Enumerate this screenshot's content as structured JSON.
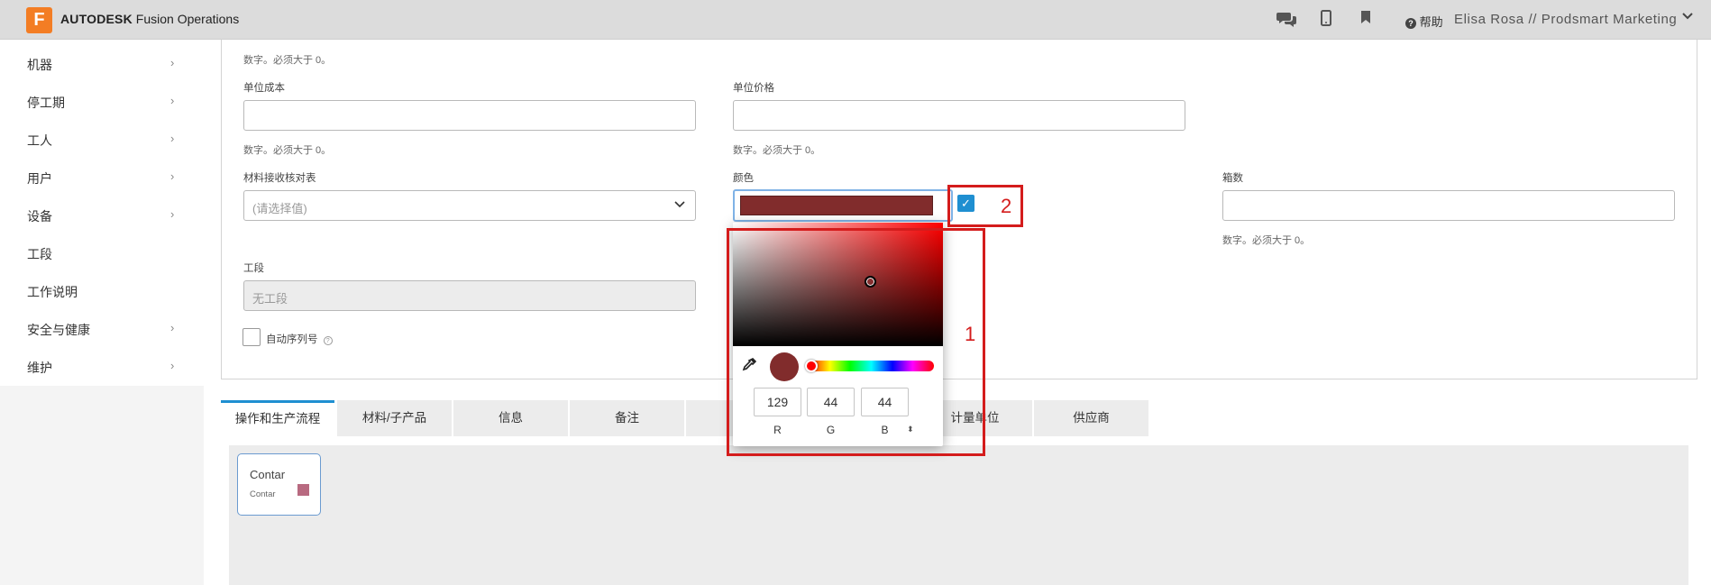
{
  "app": {
    "logo_letter": "F",
    "brand_bold": "AUTODESK",
    "brand_rest": " Fusion Operations"
  },
  "header": {
    "help_label": "帮助",
    "user_label": "Elisa Rosa // Prodsmart Marketing"
  },
  "sidebar": {
    "items": [
      {
        "label": "机器",
        "has_chevron": true
      },
      {
        "label": "停工期",
        "has_chevron": true
      },
      {
        "label": "工人",
        "has_chevron": true
      },
      {
        "label": "用户",
        "has_chevron": true
      },
      {
        "label": "设备",
        "has_chevron": true
      },
      {
        "label": "工段",
        "has_chevron": false
      },
      {
        "label": "工作说明",
        "has_chevron": false
      },
      {
        "label": "安全与健康",
        "has_chevron": true
      },
      {
        "label": "维护",
        "has_chevron": true
      }
    ],
    "chevron": "›"
  },
  "form": {
    "top_hint": "数字。必须大于 0。",
    "unit_cost": {
      "label": "单位成本",
      "value": "",
      "hint": "数字。必须大于 0。"
    },
    "unit_price": {
      "label": "单位价格",
      "value": "",
      "hint": "数字。必须大于 0。"
    },
    "material_table": {
      "label": "材料接收核对表",
      "placeholder": "(请选择值)"
    },
    "color": {
      "label": "颜色",
      "value": "#812c2c",
      "confirm_icon": "✓"
    },
    "box_count": {
      "label": "箱数",
      "value": "",
      "hint": "数字。必须大于 0。"
    },
    "section": {
      "label": "工段",
      "value": "无工段"
    },
    "auto_serial": {
      "label": "自动序列号",
      "info_icon": "?"
    }
  },
  "color_picker": {
    "current_color": "#812c2c",
    "hue_color": "#ff0000",
    "r": "129",
    "g": "44",
    "b": "44",
    "r_label": "R",
    "g_label": "G",
    "b_label": "B",
    "mode_toggle": "⬍"
  },
  "annotations": {
    "box1": "1",
    "box2": "2"
  },
  "tabs": [
    {
      "label": "操作和生产流程",
      "active": true
    },
    {
      "label": "材料/子产品"
    },
    {
      "label": "信息"
    },
    {
      "label": "备注"
    },
    {
      "label": "计量单位"
    },
    {
      "label": "供应商"
    }
  ],
  "flow_node": {
    "title": "Contar",
    "subtitle": "Contar",
    "color": "#b86a80"
  }
}
